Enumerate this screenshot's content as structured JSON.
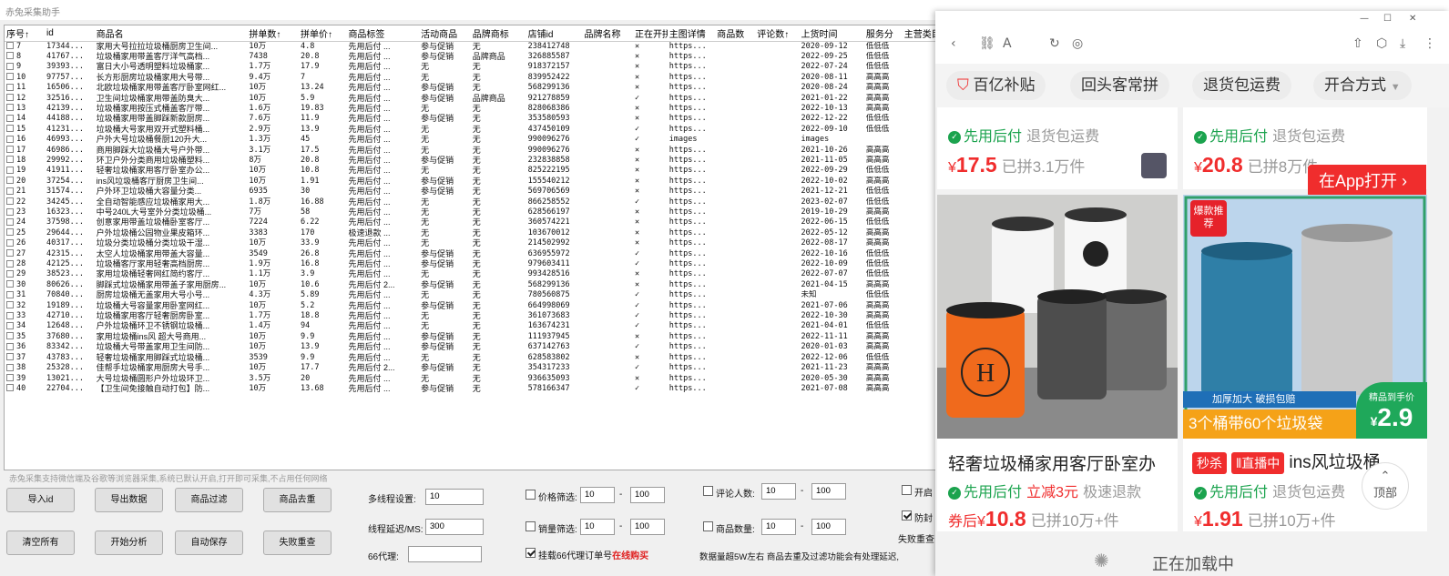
{
  "app": {
    "title": "赤兔采集助手",
    "columns": [
      "序号↑",
      "id",
      "商品名",
      "拼单数↑",
      "拼单价↑",
      "商品标签",
      "活动商品",
      "品牌商标",
      "店铺id",
      "品牌名称",
      "正在开拼",
      "主图详情",
      "商品数",
      "评论数↑",
      "上货时间",
      "服务分",
      "主营类目"
    ],
    "rows": [
      [
        "7",
        "17344...",
        "家用大号拉拉垃圾桶厨房卫生间...",
        "10万",
        "4.8",
        "先用后付 ...",
        "参与促销",
        "无",
        "238412748",
        "",
        "✕",
        "https...",
        "",
        "",
        "2020-09-12",
        "低低低"
      ],
      [
        "8",
        "41767...",
        "垃圾桶家用带盖客厅洋气高档...",
        "7438",
        "20.8",
        "先用后付 ...",
        "参与促销",
        "品牌商品",
        "326885587",
        "",
        "✕",
        "https...",
        "",
        "",
        "2022-09-25",
        "低低低"
      ],
      [
        "9",
        "39393...",
        "富日大小号透明塑料垃圾桶家...",
        "1.7万",
        "17.9",
        "先用后付 ...",
        "无",
        "无",
        "918372157",
        "",
        "✕",
        "https...",
        "",
        "",
        "2022-07-24",
        "低低低"
      ],
      [
        "10",
        "97757...",
        "长方形厨房垃圾桶家用大号带...",
        "9.4万",
        "7",
        "先用后付 ...",
        "无",
        "无",
        "839952422",
        "",
        "✕",
        "https...",
        "",
        "",
        "2020-08-11",
        "高高高"
      ],
      [
        "11",
        "16506...",
        "北欧垃圾桶家用带盖客厅卧室网红...",
        "10万",
        "13.24",
        "先用后付 ...",
        "参与促销",
        "无",
        "568299136",
        "",
        "✕",
        "https...",
        "",
        "",
        "2020-08-24",
        "高高高"
      ],
      [
        "12",
        "32516...",
        "卫生间垃圾桶家用带盖防臭大...",
        "10万",
        "5.9",
        "先用后付 ...",
        "参与促销",
        "品牌商品",
        "921278859",
        "",
        "✓",
        "https...",
        "",
        "",
        "2021-01-22",
        "高高高"
      ],
      [
        "13",
        "42139...",
        "垃圾桶家用按压式桶盖客厅带...",
        "1.6万",
        "19.83",
        "先用后付 ...",
        "无",
        "无",
        "828068386",
        "",
        "✕",
        "https...",
        "",
        "",
        "2022-10-13",
        "高高高"
      ],
      [
        "14",
        "44188...",
        "垃圾桶家用带盖脚踩新款厨房...",
        "7.6万",
        "11.9",
        "先用后付 ...",
        "参与促销",
        "无",
        "353580593",
        "",
        "✕",
        "https...",
        "",
        "",
        "2022-12-22",
        "低低低"
      ],
      [
        "15",
        "41231...",
        "垃圾桶大号家用双开式塑料桶...",
        "2.9万",
        "13.9",
        "先用后付 ...",
        "无",
        "无",
        "437450109",
        "",
        "✓",
        "https...",
        "",
        "",
        "2022-09-10",
        "低低低"
      ],
      [
        "16",
        "46993...",
        "户外大号垃圾桶餐厨120升大...",
        "1.3万",
        "45",
        "先用后付 ...",
        "无",
        "无",
        "990096276",
        "",
        "✓",
        "images",
        "",
        "",
        "images",
        ""
      ],
      [
        "17",
        "46986...",
        "商用脚踩大垃圾桶大号户外带...",
        "3.1万",
        "17.5",
        "先用后付 ...",
        "无",
        "无",
        "990096276",
        "",
        "✕",
        "https...",
        "",
        "",
        "2021-10-26",
        "高高高"
      ],
      [
        "18",
        "29992...",
        "环卫户外分类商用垃圾桶塑料...",
        "8万",
        "20.8",
        "先用后付 ...",
        "参与促销",
        "无",
        "232838858",
        "",
        "✕",
        "https...",
        "",
        "",
        "2021-11-05",
        "高高高"
      ],
      [
        "19",
        "41911...",
        "轻奢垃圾桶家用客厅卧室办公...",
        "10万",
        "10.8",
        "先用后付 ...",
        "无",
        "无",
        "825222195",
        "",
        "✕",
        "https...",
        "",
        "",
        "2022-09-29",
        "低低低"
      ],
      [
        "20",
        "37254...",
        "ins风垃圾桶客厅厨房卫生间...",
        "10万",
        "1.91",
        "先用后付 ...",
        "参与促销",
        "无",
        "155540212",
        "",
        "✕",
        "https...",
        "",
        "",
        "2022-10-02",
        "高高高"
      ],
      [
        "21",
        "31574...",
        "户外环卫垃圾桶大容量分类...",
        "6935",
        "30",
        "先用后付 ...",
        "参与促销",
        "无",
        "569706569",
        "",
        "✕",
        "https...",
        "",
        "",
        "2021-12-21",
        "低低低"
      ],
      [
        "22",
        "34245...",
        "全自动智能感应垃圾桶家用大...",
        "1.8万",
        "16.88",
        "先用后付 ...",
        "无",
        "无",
        "866258552",
        "",
        "✓",
        "https...",
        "",
        "",
        "2023-02-07",
        "低低低"
      ],
      [
        "23",
        "16323...",
        "中号240L大号室外分类垃圾桶...",
        "7万",
        "58",
        "先用后付 ...",
        "无",
        "无",
        "628566197",
        "",
        "✕",
        "https...",
        "",
        "",
        "2019-10-29",
        "高高高"
      ],
      [
        "24",
        "37598...",
        "创意家用带盖垃圾桶卧室客厅...",
        "7224",
        "6.22",
        "先用后付 ...",
        "无",
        "无",
        "360574221",
        "",
        "✕",
        "https...",
        "",
        "",
        "2022-06-15",
        "低低低"
      ],
      [
        "25",
        "29644...",
        "户外垃圾桶公园物业果皮箱环...",
        "3383",
        "170",
        "极速退款 ...",
        "无",
        "无",
        "103670012",
        "",
        "✕",
        "https...",
        "",
        "",
        "2022-05-12",
        "高高高"
      ],
      [
        "26",
        "40317...",
        "垃圾分类垃圾桶分类垃圾干湿...",
        "10万",
        "33.9",
        "先用后付 ...",
        "无",
        "无",
        "214502992",
        "",
        "✕",
        "https...",
        "",
        "",
        "2022-08-17",
        "高高高"
      ],
      [
        "27",
        "42315...",
        "太空人垃圾桶家用带盖大容量...",
        "3549",
        "26.8",
        "先用后付 ...",
        "参与促销",
        "无",
        "636955972",
        "",
        "✓",
        "https...",
        "",
        "",
        "2022-10-16",
        "低低低"
      ],
      [
        "28",
        "42125...",
        "垃圾桶客厅家用轻奢高档厨房...",
        "1.9万",
        "16.8",
        "先用后付 ...",
        "参与促销",
        "无",
        "979603411",
        "",
        "✓",
        "https...",
        "",
        "",
        "2022-10-09",
        "低低低"
      ],
      [
        "29",
        "38523...",
        "家用垃圾桶轻奢网红简约客厅...",
        "1.1万",
        "3.9",
        "先用后付 ...",
        "无",
        "无",
        "993428516",
        "",
        "✕",
        "https...",
        "",
        "",
        "2022-07-07",
        "低低低"
      ],
      [
        "30",
        "80626...",
        "脚踩式垃圾桶家用带盖子家用厨房...",
        "10万",
        "10.6",
        "先用后付 2...",
        "参与促销",
        "无",
        "568299136",
        "",
        "✕",
        "https...",
        "",
        "",
        "2021-04-15",
        "高高高"
      ],
      [
        "31",
        "70840...",
        "厨房垃圾桶无盖家用大号小号...",
        "4.3万",
        "5.89",
        "先用后付 ...",
        "无",
        "无",
        "780560875",
        "",
        "✓",
        "https...",
        "",
        "",
        "未知",
        "低低低"
      ],
      [
        "32",
        "19189...",
        "垃圾桶大号容量家用卧室网红...",
        "10万",
        "5.2",
        "先用后付 ...",
        "参与促销",
        "无",
        "664998069",
        "",
        "✓",
        "https...",
        "",
        "",
        "2021-07-06",
        "高高高"
      ],
      [
        "33",
        "42710...",
        "垃圾桶家用客厅轻奢厨房卧室...",
        "1.7万",
        "18.8",
        "先用后付 ...",
        "无",
        "无",
        "361073683",
        "",
        "✓",
        "https...",
        "",
        "",
        "2022-10-30",
        "高高高"
      ],
      [
        "34",
        "12648...",
        "户外垃圾桶环卫不锈钢垃圾桶...",
        "1.4万",
        "94",
        "先用后付 ...",
        "无",
        "无",
        "163674231",
        "",
        "✓",
        "https...",
        "",
        "",
        "2021-04-01",
        "低低低"
      ],
      [
        "35",
        "37680...",
        "家用垃圾桶ins风 超大号商用...",
        "10万",
        "9.9",
        "先用后付 ...",
        "参与促销",
        "无",
        "111937945",
        "",
        "✕",
        "https...",
        "",
        "",
        "2022-11-11",
        "高高高"
      ],
      [
        "36",
        "83342...",
        "垃圾桶大号带盖家用卫生间防...",
        "10万",
        "13.9",
        "先用后付 ...",
        "参与促销",
        "无",
        "637142763",
        "",
        "✓",
        "https...",
        "",
        "",
        "2020-01-03",
        "高高高"
      ],
      [
        "37",
        "43783...",
        "轻奢垃圾桶家用脚踩式垃圾桶...",
        "3539",
        "9.9",
        "先用后付 ...",
        "无",
        "无",
        "628583802",
        "",
        "✕",
        "https...",
        "",
        "",
        "2022-12-06",
        "低低低"
      ],
      [
        "38",
        "25328...",
        "佳帮手垃圾桶家用厨房大号手...",
        "10万",
        "17.7",
        "先用后付 2...",
        "参与促销",
        "无",
        "354317233",
        "",
        "✓",
        "https...",
        "",
        "",
        "2021-11-23",
        "高高高"
      ],
      [
        "39",
        "13021...",
        "大号垃圾桶圆形户外垃圾环卫...",
        "3.5万",
        "20",
        "先用后付 ...",
        "无",
        "无",
        "936635093",
        "",
        "✕",
        "https...",
        "",
        "",
        "2020-05-30",
        "高高高"
      ],
      [
        "40",
        "22704...",
        "【卫生间免接触自动打包】防...",
        "10万",
        "13.68",
        "先用后付 ...",
        "参与促销",
        "无",
        "578166347",
        "",
        "✓",
        "https...",
        "",
        "",
        "2021-07-08",
        "高高高"
      ]
    ],
    "note": "赤兔采集支持微信端及谷歌等浏览器采集,系统已默认开启,打开即可采集,不占用任何网络",
    "buttons": [
      "导入id",
      "导出数据",
      "商品过滤",
      "商品去重",
      "清空所有",
      "开始分析",
      "自动保存",
      "失败重查"
    ],
    "threads_label": "多线程设置:",
    "threads_value": "10",
    "delay_label": "线程延迟/MS:",
    "delay_value": "300",
    "proxy_label": "66代理:",
    "price_filter": "价格筛选:",
    "price_min": "10",
    "price_max": "100",
    "sales_filter": "销量筛选:",
    "sales_min": "10",
    "sales_max": "100",
    "review_filter": "评论人数:",
    "review_min": "10",
    "review_max": "100",
    "count_filter": "商品数量:",
    "count_min": "10",
    "count_max": "100",
    "dash": "-",
    "mount_label": "挂载66代理订单号",
    "buy_online": "在线购买",
    "hint": "数据量超5W左右 商品去重及过滤功能会有处理延迟,",
    "open_cut": "开启",
    "anti_cut": "防封",
    "fail_cut": "失败重查"
  },
  "browser": {
    "chips": [
      "百亿补贴",
      "回头客常拼",
      "退货包运费",
      "开合方式"
    ],
    "top_cards": [
      {
        "tag1": "先用后付",
        "tag2": "退货包运费",
        "currency": "¥",
        "price": "17.5",
        "sold": "已拼3.1万件"
      },
      {
        "tag1": "先用后付",
        "tag2": "退货包运费",
        "currency": "¥",
        "price": "20.8",
        "sold": "已拼8万件"
      }
    ],
    "open_app": "在App打开",
    "cards": [
      {
        "title": "轻奢垃圾桶家用客厅卧室办",
        "tag1": "先用后付",
        "tag2": "立减3元",
        "tag3": "极速退款",
        "prefix": "券后",
        "currency": "¥",
        "price": "10.8",
        "sold": "已拼10万+件"
      },
      {
        "badge1": "秒杀",
        "badge2": "直播中",
        "title": "ins风垃圾桶",
        "tag1": "先用后付",
        "tag2": "退货包运费",
        "currency": "¥",
        "price": "1.91",
        "sold": "已拼10万+件"
      }
    ],
    "promo": {
      "hot": "爆款推荐",
      "strip": "加厚加大 破损包赔",
      "banner": "3个桶带60个垃圾袋",
      "fine_label": "精品到手价",
      "fine_price": "2.9"
    },
    "top_button": "顶部",
    "loading": "正在加载中",
    "accent": "#f02d2d",
    "green": "#1ba34e"
  }
}
